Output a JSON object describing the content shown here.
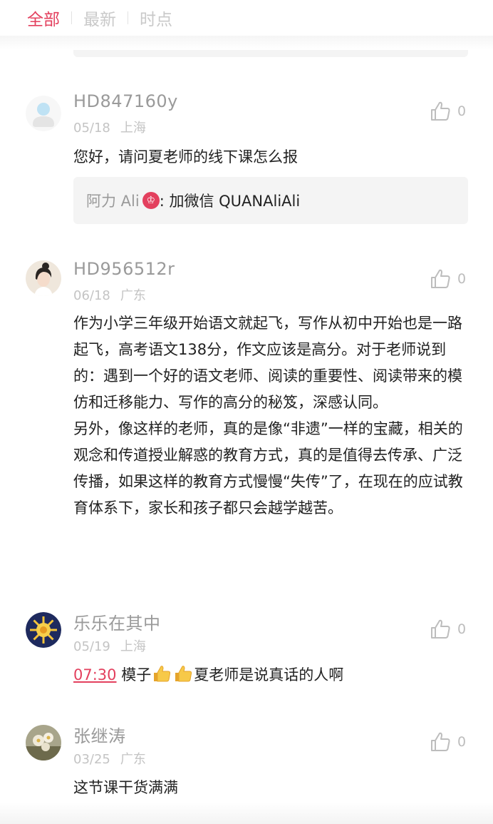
{
  "tabs": [
    {
      "label": "全部",
      "active": true
    },
    {
      "label": "最新",
      "active": false
    },
    {
      "label": "时点",
      "active": false
    }
  ],
  "accent_color": "#e3405e",
  "comments": [
    {
      "username": "HD847160y",
      "date": "05/18",
      "location": "上海",
      "likes": "0",
      "text": "您好，请问夏老师的线下课怎么报",
      "avatar_icon": "default-user-icon",
      "reply": {
        "author": "阿力 Ali",
        "badge": "♔",
        "text": ": 加微信 QUANAliAli"
      }
    },
    {
      "username": "HD956512r",
      "date": "06/18",
      "location": "广东",
      "likes": "0",
      "avatar_icon": "girl-photo-avatar",
      "paragraphs": [
        "作为小学三年级开始语文就起飞，写作从初中开始也是一路起飞，高考语文138分，作文应该是高分。对于老师说到的：遇到一个好的语文老师、阅读的重要性、阅读带来的模仿和迁移能力、写作的高分的秘笈，深感认同。",
        "另外，像这样的老师，真的是像“非遗”一样的宝藏，相关的观念和传道授业解惑的教育方式，真的是值得去传承、广泛传播，如果这样的教育方式慢慢“失传”了，在现在的应试教育体系下，家长和孩子都只会越学越苦。"
      ]
    },
    {
      "username": "乐乐在其中",
      "date": "05/19",
      "location": "上海",
      "likes": "0",
      "avatar_icon": "sun-emblem-avatar",
      "timestamp": "07:30",
      "text_before": " 模子",
      "emojis": [
        "thumbs-up-emoji",
        "thumbs-up-emoji"
      ],
      "text_after": "夏老师是说真话的人啊"
    },
    {
      "username": "张继涛",
      "date": "03/25",
      "location": "广东",
      "likes": "0",
      "avatar_icon": "flower-photo-avatar",
      "text": "这节课干货满满"
    }
  ]
}
